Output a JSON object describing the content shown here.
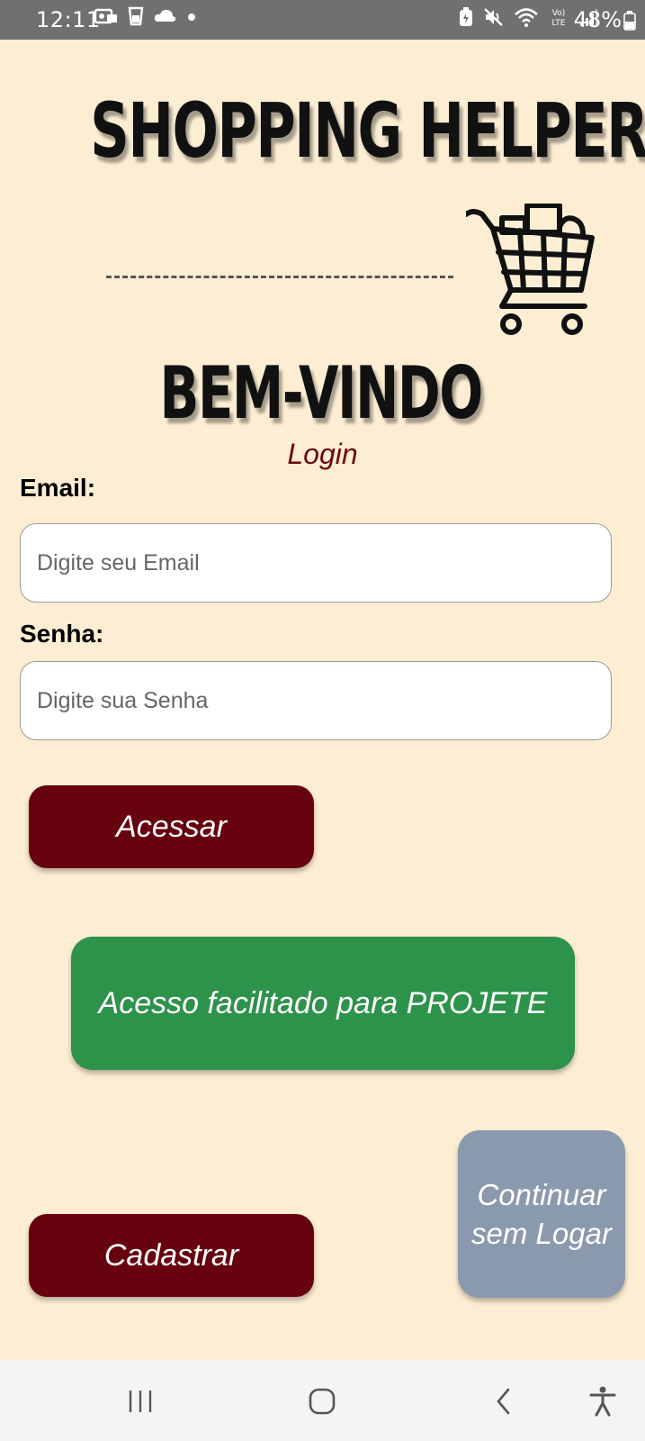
{
  "status_bar": {
    "time": "12:11",
    "battery": "48%",
    "left_icons": [
      "photo-message-icon",
      "cup-icon",
      "cloud-icon",
      "dot-icon"
    ],
    "right_icons": [
      "battery-saver-icon",
      "mute-icon",
      "wifi-icon",
      "volte-icon",
      "signal-icon"
    ]
  },
  "header": {
    "app_title": "SHOPPING HELPER",
    "logo_icon": "shopping-cart-icon",
    "welcome": "BEM-VINDO",
    "subtitle": "Login"
  },
  "form": {
    "email_label": "Email:",
    "email_placeholder": "Digite seu Email",
    "email_value": "",
    "password_label": "Senha:",
    "password_placeholder": "Digite sua Senha",
    "password_value": ""
  },
  "buttons": {
    "login": "Acessar",
    "projete": "Acesso facilitado para PROJETE",
    "register": "Cadastrar",
    "guest_line1": "Continuar",
    "guest_line2": "sem Logar"
  },
  "colors": {
    "background": "#fdeed3",
    "primary_dark_red": "#67030f",
    "green": "#2d924a",
    "grey_blue": "#8b99ae",
    "subtitle": "#6b0712"
  },
  "nav_bar": {
    "items": [
      "recent-apps-icon",
      "home-icon",
      "back-icon",
      "accessibility-icon"
    ]
  }
}
